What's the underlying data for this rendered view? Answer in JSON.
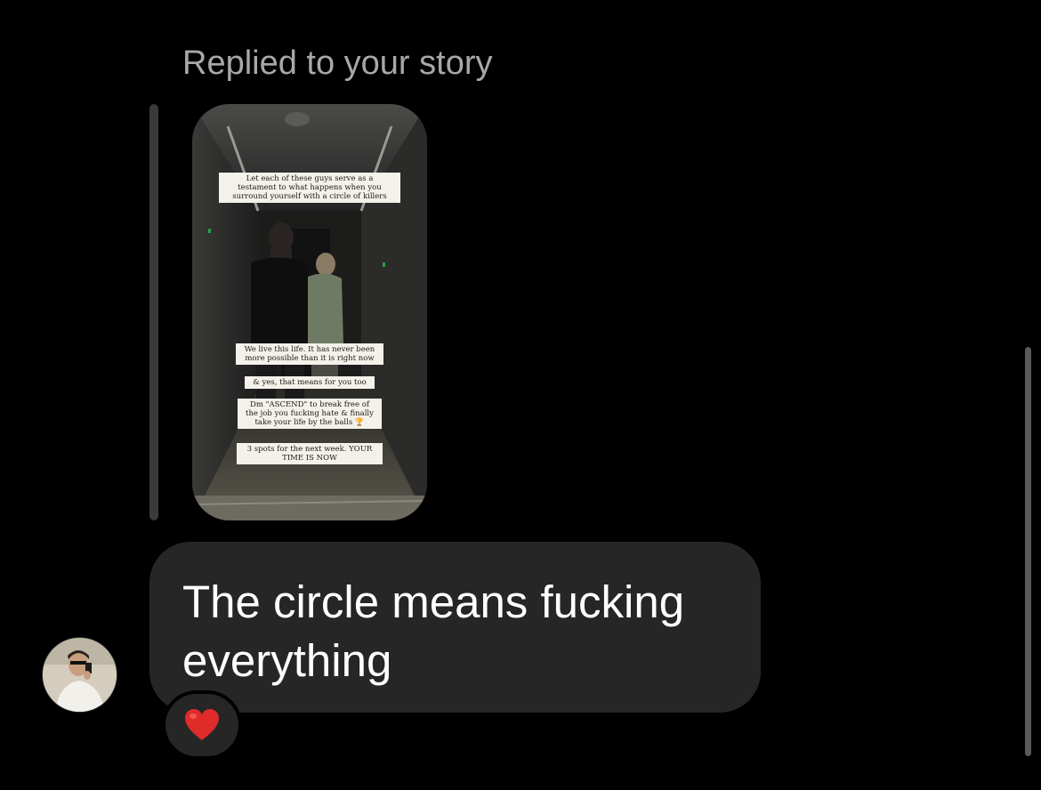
{
  "reply": {
    "label": "Replied to your story"
  },
  "story": {
    "captions": [
      "Let each of these guys serve as a\ntestament to what happens when you\nsurround yourself with a circle of killers",
      "We live this life. It has never been\nmore possible than it is right now",
      "& yes, that means for you too",
      "Dm \"ASCEND\" to break free of\nthe job you fucking hate & finally\ntake your life by the balls 🏆",
      "3 spots for the next week. YOUR\nTIME IS NOW"
    ]
  },
  "message": {
    "text": "The circle means fucking everything",
    "reaction": "heart-emoji"
  },
  "colors": {
    "background": "#000000",
    "bubble": "#262626",
    "reply_label": "#a8a8a8",
    "reaction_heart": "#e02b2b"
  }
}
